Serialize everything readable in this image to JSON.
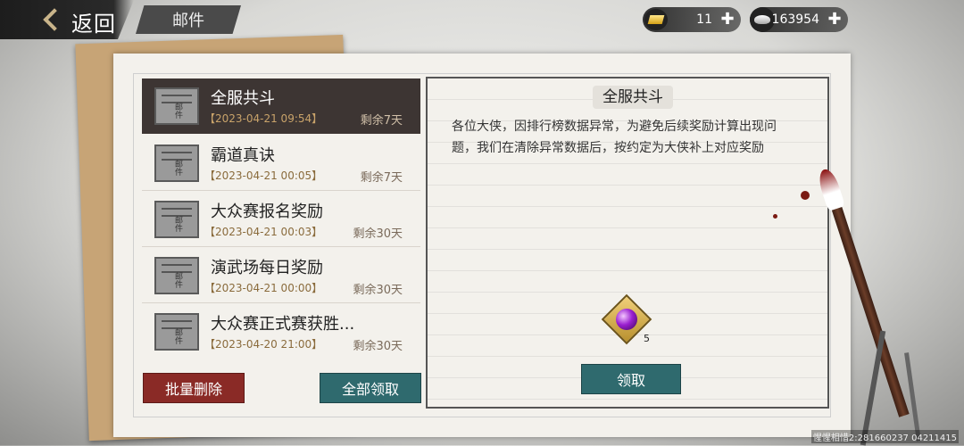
{
  "header": {
    "back_label": "返回",
    "title": "邮件"
  },
  "resources": {
    "gold": {
      "icon": "gold-ingot-icon",
      "value": "11"
    },
    "silver": {
      "icon": "silver-ingot-icon",
      "value": "163954"
    }
  },
  "mail_list": [
    {
      "subject": "全服共斗",
      "date": "【2023-04-21 09:54】",
      "remaining": "剩余7天",
      "selected": true,
      "envelope_text": "邮件"
    },
    {
      "subject": "霸道真诀",
      "date": "【2023-04-21 00:05】",
      "remaining": "剩余7天",
      "selected": false,
      "envelope_text": "邮件"
    },
    {
      "subject": "大众赛报名奖励",
      "date": "【2023-04-21 00:03】",
      "remaining": "剩余30天",
      "selected": false,
      "envelope_text": "邮件"
    },
    {
      "subject": "演武场每日奖励",
      "date": "【2023-04-21 00:00】",
      "remaining": "剩余30天",
      "selected": false,
      "envelope_text": "邮件"
    },
    {
      "subject": "大众赛正式赛获胜...",
      "date": "【2023-04-20 21:00】",
      "remaining": "剩余30天",
      "selected": false,
      "envelope_text": "邮件"
    }
  ],
  "buttons": {
    "batch_delete": "批量删除",
    "claim_all": "全部领取",
    "claim": "领取"
  },
  "detail": {
    "title": "全服共斗",
    "body": "各位大侠，因排行榜数据异常，为避免后续奖励计算出现问题，我们在清除异常数据后，按约定为大侠补上对应奖励",
    "reward": {
      "icon": "purple-gem-icon",
      "count": "5"
    }
  },
  "watermark": "惺惺相惜2:281660237 04211415"
}
